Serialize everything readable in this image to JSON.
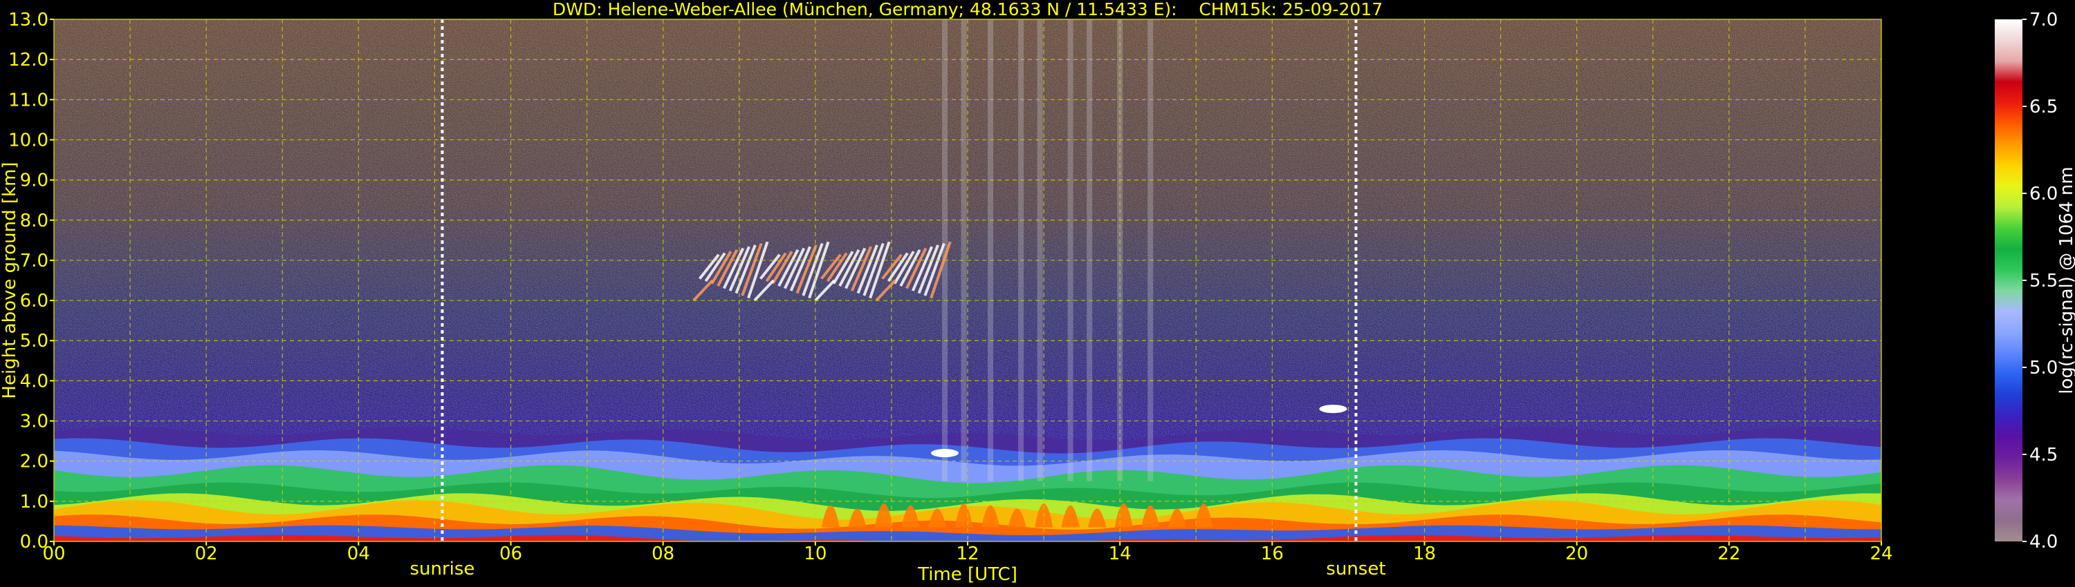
{
  "chart_data": {
    "type": "heatmap",
    "title": "DWD: Helene-Weber-Allee (München, Germany; 48.1633 N / 11.5433 E):    CHM15k: 25-09-2017",
    "xlabel": "Time [UTC]",
    "ylabel": "Height above ground [km]",
    "xlim": [
      0,
      24
    ],
    "ylim": [
      0,
      13
    ],
    "x_ticks": [
      "00",
      "02",
      "04",
      "06",
      "08",
      "10",
      "12",
      "14",
      "16",
      "18",
      "20",
      "22",
      "24"
    ],
    "y_ticks": [
      "0.0",
      "1.0",
      "2.0",
      "3.0",
      "4.0",
      "5.0",
      "6.0",
      "7.0",
      "8.0",
      "9.0",
      "10.0",
      "11.0",
      "12.0",
      "13.0"
    ],
    "grid": true,
    "colorbar": {
      "label": "log(rc-signal) @ 1064 nm",
      "range": [
        4.0,
        7.0
      ],
      "ticks": [
        "4.0",
        "4.5",
        "5.0",
        "5.5",
        "6.0",
        "6.5",
        "7.0"
      ]
    },
    "markers": [
      {
        "label": "sunrise",
        "x": 5.1
      },
      {
        "label": "sunset",
        "x": 17.1
      }
    ],
    "features": {
      "boundary_layer_top_km": [
        {
          "x": 0,
          "top": 2.7
        },
        {
          "x": 4,
          "top": 2.6
        },
        {
          "x": 8,
          "top": 2.4
        },
        {
          "x": 11,
          "top": 2.3
        },
        {
          "x": 14,
          "top": 2.4
        },
        {
          "x": 17,
          "top": 2.6
        },
        {
          "x": 20,
          "top": 2.5
        },
        {
          "x": 24,
          "top": 2.8
        }
      ],
      "cirrus_cloud": {
        "x_start": 8.4,
        "x_end": 11.6,
        "height_km": [
          6.0,
          8.0
        ]
      },
      "low_clouds": [
        {
          "x": 11.7,
          "height_km": 2.2
        },
        {
          "x": 16.8,
          "height_km": 3.3
        }
      ]
    }
  },
  "colors": {
    "background": "#000000",
    "text": "#ffff00",
    "colorbar_text": "#ffffff",
    "grid": "#d4d400",
    "colormap": [
      "#a38d8d",
      "#8f6f8f",
      "#a070a8",
      "#8a3d96",
      "#6b1f9e",
      "#5a10a6",
      "#3a22c0",
      "#1f3fd8",
      "#2b63f0",
      "#5f86ff",
      "#8aa6ff",
      "#a8b8ff",
      "#7fd8a0",
      "#2ec85a",
      "#13b040",
      "#4ad13a",
      "#b6f03a",
      "#e8f518",
      "#ffd200",
      "#ff9a00",
      "#ff5a00",
      "#ee1a0f",
      "#c80010",
      "#e6a8a8",
      "#f0d8d8",
      "#ffffff"
    ]
  }
}
